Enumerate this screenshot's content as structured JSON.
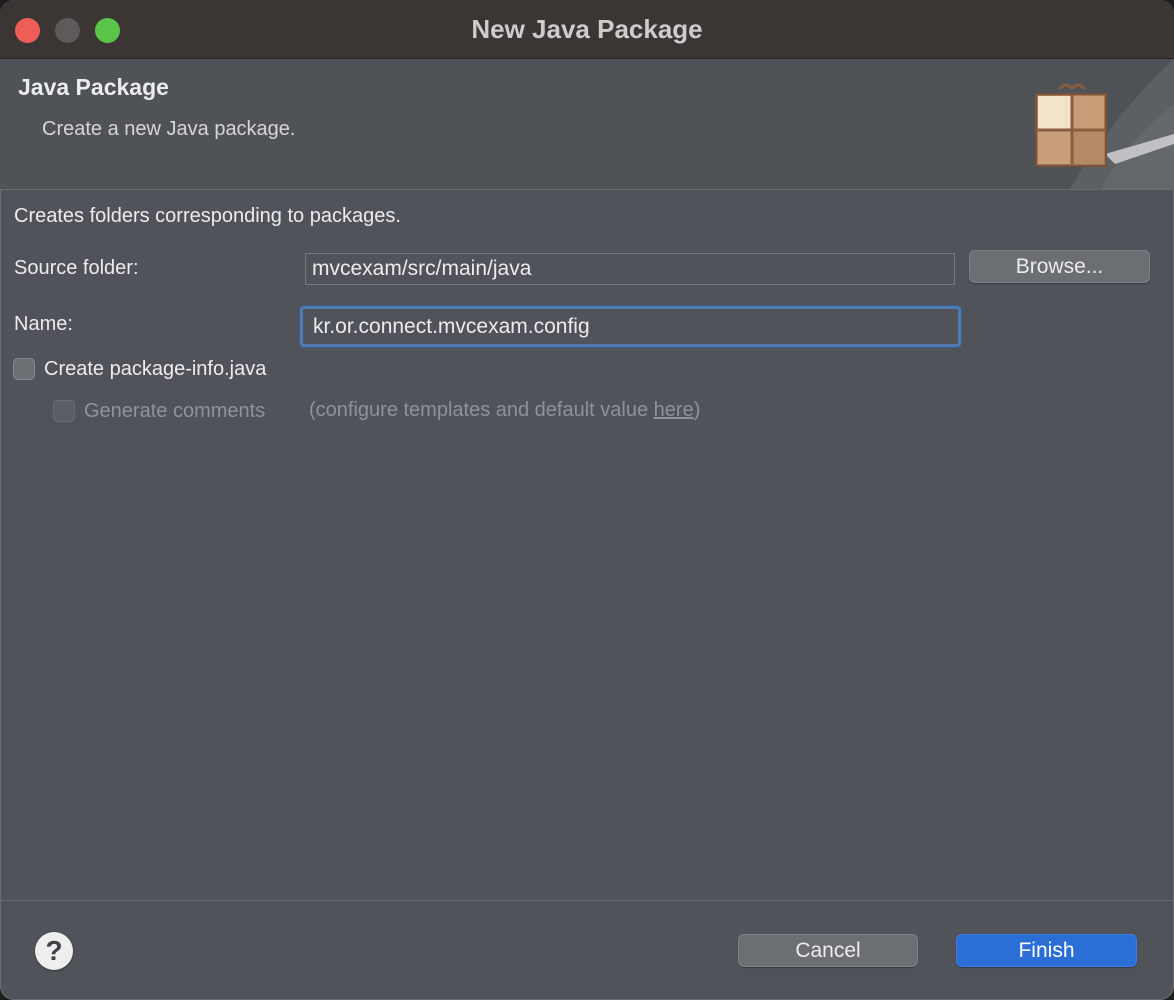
{
  "window": {
    "title": "New Java Package"
  },
  "banner": {
    "title": "Java Package",
    "description": "Create a new Java package.",
    "icon": "package-icon"
  },
  "main": {
    "description": "Creates folders corresponding to packages.",
    "source_folder": {
      "label": "Source folder:",
      "value": "mvcexam/src/main/java",
      "browse_label": "Browse..."
    },
    "name": {
      "label": "Name:",
      "value": "kr.or.connect.mvcexam.config"
    },
    "create_package_info": {
      "label": "Create package-info.java",
      "checked": false
    },
    "generate_comments": {
      "label": "Generate comments",
      "checked": false,
      "enabled": false,
      "hint_prefix": "(configure templates and default value ",
      "hint_link": "here",
      "hint_suffix": ")"
    }
  },
  "footer": {
    "help_icon": "help-icon",
    "help_glyph": "?",
    "cancel_label": "Cancel",
    "finish_label": "Finish"
  },
  "colors": {
    "accent": "#2b6fd6",
    "focus_ring": "#4f7bb0",
    "close": "#ee5e57",
    "maximize": "#5bc549"
  }
}
